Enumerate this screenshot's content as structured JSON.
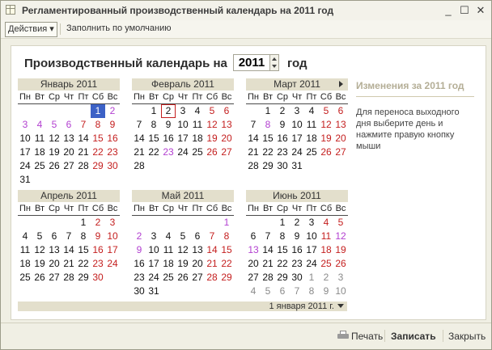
{
  "window": {
    "title": "Регламентированный производственный календарь на 2011 год"
  },
  "toolbar": {
    "actions_label": "Действия",
    "actions_arrow": "▾",
    "fill_default_label": "Заполнить по умолчанию"
  },
  "header": {
    "prefix": "Производственный календарь на",
    "year": "2011",
    "suffix": "год"
  },
  "weekdays": [
    "Пн",
    "Вт",
    "Ср",
    "Чт",
    "Пт",
    "Сб",
    "Вс"
  ],
  "months": [
    {
      "name": "Январь 2011",
      "nav": false,
      "weeks": [
        [
          {
            "d": ""
          },
          {
            "d": ""
          },
          {
            "d": ""
          },
          {
            "d": ""
          },
          {
            "d": ""
          },
          {
            "d": "1",
            "t": "selected"
          },
          {
            "d": "2",
            "t": "violet"
          }
        ],
        [
          {
            "d": "3",
            "t": "violet"
          },
          {
            "d": "4",
            "t": "violet"
          },
          {
            "d": "5",
            "t": "violet"
          },
          {
            "d": "6",
            "t": "violet"
          },
          {
            "d": "7",
            "t": "red"
          },
          {
            "d": "8",
            "t": "red"
          },
          {
            "d": "9",
            "t": "red"
          }
        ],
        [
          {
            "d": "10"
          },
          {
            "d": "11"
          },
          {
            "d": "12"
          },
          {
            "d": "13"
          },
          {
            "d": "14"
          },
          {
            "d": "15",
            "t": "red"
          },
          {
            "d": "16",
            "t": "red"
          }
        ],
        [
          {
            "d": "17"
          },
          {
            "d": "18"
          },
          {
            "d": "19"
          },
          {
            "d": "20"
          },
          {
            "d": "21"
          },
          {
            "d": "22",
            "t": "red"
          },
          {
            "d": "23",
            "t": "red"
          }
        ],
        [
          {
            "d": "24"
          },
          {
            "d": "25"
          },
          {
            "d": "26"
          },
          {
            "d": "27"
          },
          {
            "d": "28"
          },
          {
            "d": "29",
            "t": "red"
          },
          {
            "d": "30",
            "t": "red"
          }
        ],
        [
          {
            "d": "31"
          },
          {
            "d": ""
          },
          {
            "d": ""
          },
          {
            "d": ""
          },
          {
            "d": ""
          },
          {
            "d": ""
          },
          {
            "d": ""
          }
        ]
      ]
    },
    {
      "name": "Февраль 2011",
      "nav": false,
      "weeks": [
        [
          {
            "d": ""
          },
          {
            "d": "1"
          },
          {
            "d": "2",
            "t": "today"
          },
          {
            "d": "3"
          },
          {
            "d": "4"
          },
          {
            "d": "5",
            "t": "red"
          },
          {
            "d": "6",
            "t": "red"
          }
        ],
        [
          {
            "d": "7"
          },
          {
            "d": "8"
          },
          {
            "d": "9"
          },
          {
            "d": "10"
          },
          {
            "d": "11"
          },
          {
            "d": "12",
            "t": "red"
          },
          {
            "d": "13",
            "t": "red"
          }
        ],
        [
          {
            "d": "14"
          },
          {
            "d": "15"
          },
          {
            "d": "16"
          },
          {
            "d": "17"
          },
          {
            "d": "18"
          },
          {
            "d": "19",
            "t": "red"
          },
          {
            "d": "20",
            "t": "red"
          }
        ],
        [
          {
            "d": "21"
          },
          {
            "d": "22"
          },
          {
            "d": "23",
            "t": "violet"
          },
          {
            "d": "24"
          },
          {
            "d": "25"
          },
          {
            "d": "26",
            "t": "red"
          },
          {
            "d": "27",
            "t": "red"
          }
        ],
        [
          {
            "d": "28"
          },
          {
            "d": ""
          },
          {
            "d": ""
          },
          {
            "d": ""
          },
          {
            "d": ""
          },
          {
            "d": ""
          },
          {
            "d": ""
          }
        ]
      ]
    },
    {
      "name": "Март 2011",
      "nav": true,
      "weeks": [
        [
          {
            "d": ""
          },
          {
            "d": "1"
          },
          {
            "d": "2"
          },
          {
            "d": "3"
          },
          {
            "d": "4"
          },
          {
            "d": "5",
            "t": "red"
          },
          {
            "d": "6",
            "t": "red"
          }
        ],
        [
          {
            "d": "7"
          },
          {
            "d": "8",
            "t": "violet"
          },
          {
            "d": "9"
          },
          {
            "d": "10"
          },
          {
            "d": "11"
          },
          {
            "d": "12",
            "t": "red"
          },
          {
            "d": "13",
            "t": "red"
          }
        ],
        [
          {
            "d": "14"
          },
          {
            "d": "15"
          },
          {
            "d": "16"
          },
          {
            "d": "17"
          },
          {
            "d": "18"
          },
          {
            "d": "19",
            "t": "red"
          },
          {
            "d": "20",
            "t": "red"
          }
        ],
        [
          {
            "d": "21"
          },
          {
            "d": "22"
          },
          {
            "d": "23"
          },
          {
            "d": "24"
          },
          {
            "d": "25"
          },
          {
            "d": "26",
            "t": "red"
          },
          {
            "d": "27",
            "t": "red"
          }
        ],
        [
          {
            "d": "28"
          },
          {
            "d": "29"
          },
          {
            "d": "30"
          },
          {
            "d": "31"
          },
          {
            "d": ""
          },
          {
            "d": ""
          },
          {
            "d": ""
          }
        ]
      ]
    },
    {
      "name": "Апрель 2011",
      "nav": false,
      "weeks": [
        [
          {
            "d": ""
          },
          {
            "d": ""
          },
          {
            "d": ""
          },
          {
            "d": ""
          },
          {
            "d": "1"
          },
          {
            "d": "2",
            "t": "red"
          },
          {
            "d": "3",
            "t": "red"
          }
        ],
        [
          {
            "d": "4"
          },
          {
            "d": "5"
          },
          {
            "d": "6"
          },
          {
            "d": "7"
          },
          {
            "d": "8"
          },
          {
            "d": "9",
            "t": "red"
          },
          {
            "d": "10",
            "t": "red"
          }
        ],
        [
          {
            "d": "11"
          },
          {
            "d": "12"
          },
          {
            "d": "13"
          },
          {
            "d": "14"
          },
          {
            "d": "15"
          },
          {
            "d": "16",
            "t": "red"
          },
          {
            "d": "17",
            "t": "red"
          }
        ],
        [
          {
            "d": "18"
          },
          {
            "d": "19"
          },
          {
            "d": "20"
          },
          {
            "d": "21"
          },
          {
            "d": "22"
          },
          {
            "d": "23",
            "t": "red"
          },
          {
            "d": "24",
            "t": "red"
          }
        ],
        [
          {
            "d": "25"
          },
          {
            "d": "26"
          },
          {
            "d": "27"
          },
          {
            "d": "28"
          },
          {
            "d": "29"
          },
          {
            "d": "30",
            "t": "red"
          },
          {
            "d": ""
          }
        ]
      ]
    },
    {
      "name": "Май 2011",
      "nav": false,
      "weeks": [
        [
          {
            "d": ""
          },
          {
            "d": ""
          },
          {
            "d": ""
          },
          {
            "d": ""
          },
          {
            "d": ""
          },
          {
            "d": ""
          },
          {
            "d": "1",
            "t": "violet"
          }
        ],
        [
          {
            "d": "2",
            "t": "violet"
          },
          {
            "d": "3"
          },
          {
            "d": "4"
          },
          {
            "d": "5"
          },
          {
            "d": "6"
          },
          {
            "d": "7",
            "t": "red"
          },
          {
            "d": "8",
            "t": "red"
          }
        ],
        [
          {
            "d": "9",
            "t": "violet"
          },
          {
            "d": "10"
          },
          {
            "d": "11"
          },
          {
            "d": "12"
          },
          {
            "d": "13"
          },
          {
            "d": "14",
            "t": "red"
          },
          {
            "d": "15",
            "t": "red"
          }
        ],
        [
          {
            "d": "16"
          },
          {
            "d": "17"
          },
          {
            "d": "18"
          },
          {
            "d": "19"
          },
          {
            "d": "20"
          },
          {
            "d": "21",
            "t": "red"
          },
          {
            "d": "22",
            "t": "red"
          }
        ],
        [
          {
            "d": "23"
          },
          {
            "d": "24"
          },
          {
            "d": "25"
          },
          {
            "d": "26"
          },
          {
            "d": "27"
          },
          {
            "d": "28",
            "t": "red"
          },
          {
            "d": "29",
            "t": "red"
          }
        ],
        [
          {
            "d": "30"
          },
          {
            "d": "31"
          },
          {
            "d": ""
          },
          {
            "d": ""
          },
          {
            "d": ""
          },
          {
            "d": ""
          },
          {
            "d": ""
          }
        ]
      ]
    },
    {
      "name": "Июнь 2011",
      "nav": false,
      "weeks": [
        [
          {
            "d": ""
          },
          {
            "d": ""
          },
          {
            "d": "1"
          },
          {
            "d": "2"
          },
          {
            "d": "3"
          },
          {
            "d": "4",
            "t": "red"
          },
          {
            "d": "5",
            "t": "red"
          }
        ],
        [
          {
            "d": "6"
          },
          {
            "d": "7"
          },
          {
            "d": "8"
          },
          {
            "d": "9"
          },
          {
            "d": "10"
          },
          {
            "d": "11",
            "t": "red"
          },
          {
            "d": "12",
            "t": "violet"
          }
        ],
        [
          {
            "d": "13",
            "t": "violet"
          },
          {
            "d": "14"
          },
          {
            "d": "15"
          },
          {
            "d": "16"
          },
          {
            "d": "17"
          },
          {
            "d": "18",
            "t": "red"
          },
          {
            "d": "19",
            "t": "red"
          }
        ],
        [
          {
            "d": "20"
          },
          {
            "d": "21"
          },
          {
            "d": "22"
          },
          {
            "d": "23"
          },
          {
            "d": "24"
          },
          {
            "d": "25",
            "t": "red"
          },
          {
            "d": "26",
            "t": "red"
          }
        ],
        [
          {
            "d": "27"
          },
          {
            "d": "28"
          },
          {
            "d": "29"
          },
          {
            "d": "30"
          },
          {
            "d": "1",
            "t": "grey"
          },
          {
            "d": "2",
            "t": "grey"
          },
          {
            "d": "3",
            "t": "grey"
          }
        ],
        [
          {
            "d": "4",
            "t": "grey"
          },
          {
            "d": "5",
            "t": "grey"
          },
          {
            "d": "6",
            "t": "grey"
          },
          {
            "d": "7",
            "t": "grey"
          },
          {
            "d": "8",
            "t": "grey"
          },
          {
            "d": "9",
            "t": "grey"
          },
          {
            "d": "10",
            "t": "grey"
          }
        ]
      ]
    }
  ],
  "bottom_date": "1 января 2011 г.",
  "changes": {
    "title": "Изменения за 2011 год",
    "hint": "Для переноса выходного дня выберите день и нажмите правую кнопку мыши"
  },
  "footer": {
    "print_label": "Печать",
    "save_label": "Записать",
    "close_label": "Закрыть"
  },
  "colors": {
    "holiday_red": "#c41e1e",
    "moved_violet": "#b23fd0",
    "selected_blue": "#3c61c6",
    "inactive_grey": "#8a8a8a"
  },
  "icons": {
    "app": "calendar-table-icon",
    "print": "printer-icon",
    "minimize": "minimize-icon",
    "maximize": "maximize-icon",
    "close": "close-icon"
  }
}
